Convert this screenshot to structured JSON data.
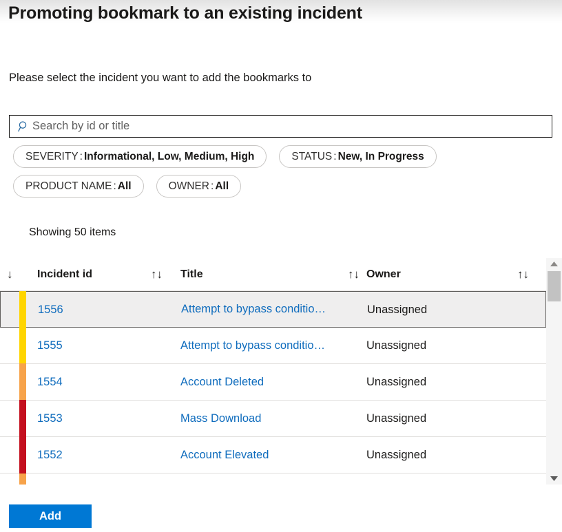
{
  "page": {
    "title": "Promoting bookmark to an existing incident",
    "instruction": "Please select the incident you want to add the bookmarks to"
  },
  "search": {
    "placeholder": "Search by id or title",
    "value": "",
    "icon": "search-icon"
  },
  "filters": [
    {
      "key": "SEVERITY",
      "sep": ":",
      "value": "Informational, Low, Medium, High"
    },
    {
      "key": "STATUS",
      "sep": ":",
      "value": "New, In Progress"
    },
    {
      "key": "PRODUCT NAME",
      "sep": ":",
      "value": "All"
    },
    {
      "key": "OWNER",
      "sep": ":",
      "value": "All"
    }
  ],
  "results": {
    "showing": "Showing 50 items"
  },
  "table": {
    "columns": [
      {
        "label": "",
        "sort_icon": "↓",
        "name": "severity"
      },
      {
        "label": "Incident id",
        "sort_icon": "↑↓",
        "name": "incident-id"
      },
      {
        "label": "Title",
        "sort_icon": "↑↓",
        "name": "title"
      },
      {
        "label": "Owner",
        "sort_icon": "↑↓",
        "name": "owner"
      }
    ],
    "rows": [
      {
        "severity_color": "#ffd500",
        "severity": "Medium",
        "id": "1556",
        "title": "Attempt to bypass conditio…",
        "owner": "Unassigned",
        "selected": true
      },
      {
        "severity_color": "#ffd500",
        "severity": "Medium",
        "id": "1555",
        "title": "Attempt to bypass conditio…",
        "owner": "Unassigned",
        "selected": false
      },
      {
        "severity_color": "#f7a34a",
        "severity": "Low",
        "id": "1554",
        "title": "Account Deleted",
        "owner": "Unassigned",
        "selected": false
      },
      {
        "severity_color": "#c4101f",
        "severity": "High",
        "id": "1553",
        "title": "Mass Download",
        "owner": "Unassigned",
        "selected": false
      },
      {
        "severity_color": "#c4101f",
        "severity": "High",
        "id": "1552",
        "title": "Account Elevated",
        "owner": "Unassigned",
        "selected": false
      }
    ],
    "partial_row": {
      "severity_color": "#f7a34a",
      "severity": "Low"
    }
  },
  "scrollbar": {
    "up_arrow": "▲",
    "down_arrow": "▼"
  },
  "footer": {
    "add_label": "Add"
  },
  "colors": {
    "accent": "#0078d4",
    "link": "#0f6cbd",
    "severity_high": "#c4101f",
    "severity_medium": "#ffd500",
    "severity_low": "#f7a34a"
  }
}
